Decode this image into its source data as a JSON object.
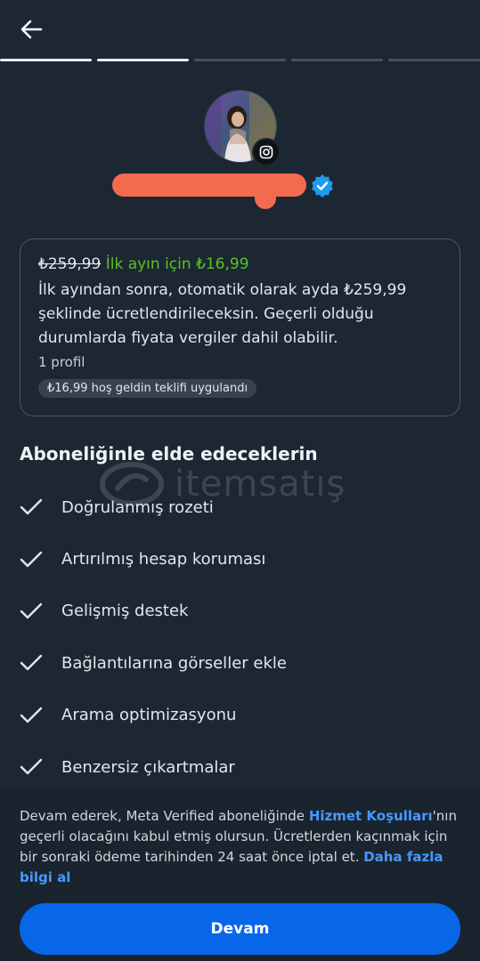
{
  "header": {
    "back_icon": "arrow-left-icon",
    "progress_steps": 5,
    "progress_completed": 2
  },
  "profile": {
    "avatar_icon": "profile-photo",
    "platform_badge_icon": "instagram-icon",
    "verified_icon": "verified-badge-icon"
  },
  "offer": {
    "old_price": "₺259,99",
    "promo_text": "İlk ayın için ₺16,99",
    "description": "İlk ayından sonra, otomatik olarak ayda ₺259,99 şeklinde ücretlendirileceksin. Geçerli olduğu durumlarda fiyata vergiler dahil olabilir.",
    "profiles": "1 profil",
    "chip": "₺16,99 hoş geldin teklifi uygulandı"
  },
  "benefits": {
    "title": "Aboneliğinle elde edeceklerin",
    "items": [
      {
        "label": "Doğrulanmış rozeti"
      },
      {
        "label": "Artırılmış hesap koruması"
      },
      {
        "label": "Gelişmiş destek"
      },
      {
        "label": "Bağlantılarına görseller ekle"
      },
      {
        "label": "Arama optimizasyonu"
      },
      {
        "label": "Benzersiz çıkartmalar"
      }
    ]
  },
  "watermark": {
    "text": "itemsatış"
  },
  "footer": {
    "text_1": "Devam ederek, Meta Verified aboneliğinde ",
    "terms_link": "Hizmet Koşulları",
    "text_2": "'nın geçerli olacağını kabul etmiş olursun. Ücretlerden kaçınmak için bir sonraki ödeme tarihinden 24 saat önce iptal et. ",
    "learn_more_link": "Daha fazla bilgi al",
    "continue_label": "Devam"
  },
  "colors": {
    "background": "#1c2733",
    "promo_green": "#58c322",
    "link_blue": "#4599ff",
    "button_blue": "#0866e8",
    "verified_blue": "#1d9bf0",
    "redaction": "#f36b4f"
  }
}
